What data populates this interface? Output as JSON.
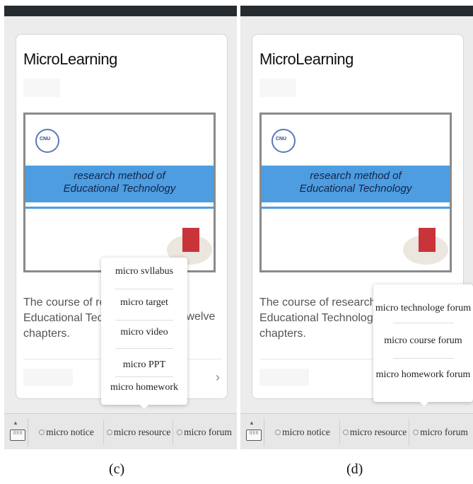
{
  "screens": [
    {
      "app_title": "MicroLearning",
      "slide": {
        "logo_text": "CNU",
        "line1": "research method of",
        "line2": "Educational Technology"
      },
      "description": {
        "line1": "The course of re",
        "line2": "Educational Tech",
        "line3": "chapters.",
        "tail": "twelve"
      },
      "tabbar": {
        "keyboard_icon": "keyboard-icon",
        "tab1": "micro notice",
        "tab2": "micro resource",
        "tab3": "micro forum"
      },
      "popup": {
        "items": [
          "micro svllabus",
          "micro target",
          "micro video",
          "micro PPT",
          "micro homework"
        ]
      },
      "caption": "(c)"
    },
    {
      "app_title": "MicroLearning",
      "slide": {
        "logo_text": "CNU",
        "line1": "research method of",
        "line2": "Educational Technology"
      },
      "description": {
        "line1": "The course of research r",
        "line2": "Educational Technology",
        "line3": "chapters."
      },
      "tabbar": {
        "keyboard_icon": "keyboard-icon",
        "tab1": "micro notice",
        "tab2": "micro resource",
        "tab3": "micro forum"
      },
      "popup": {
        "items": [
          "micro technologe forum",
          "micro course forum",
          "micro homework forum"
        ]
      },
      "caption": "(d)"
    }
  ],
  "colors": {
    "status_bar": "#262b30",
    "banner": "#4d9de0",
    "background": "#ececec"
  }
}
